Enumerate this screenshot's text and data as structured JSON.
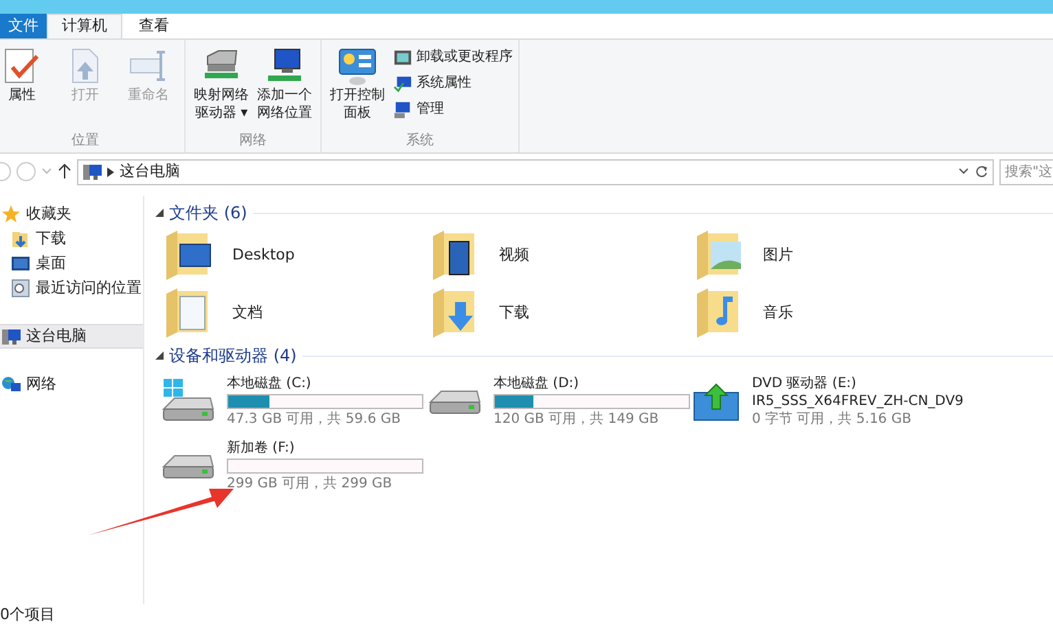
{
  "ribbon": {
    "tabs": [
      {
        "label": "文件",
        "kind": "file",
        "selected": false
      },
      {
        "label": "计算机",
        "kind": "tab",
        "selected": true
      },
      {
        "label": "查看",
        "kind": "tab",
        "selected": false
      }
    ],
    "groups": [
      {
        "label": "位置",
        "items": [
          {
            "label": "属性",
            "kind": "props",
            "disabled": false
          },
          {
            "label": "打开",
            "kind": "open",
            "disabled": true
          },
          {
            "label": "重命名",
            "kind": "rename",
            "disabled": true
          }
        ]
      },
      {
        "label": "网络",
        "items": [
          {
            "label": "映射网络驱动器 ▾",
            "kind": "mapdrive",
            "disabled": false
          },
          {
            "label": "添加一个网络位置",
            "kind": "netloc",
            "disabled": false
          }
        ]
      },
      {
        "label": "系统",
        "items": [
          {
            "label": "打开控制面板",
            "kind": "control",
            "disabled": false
          }
        ],
        "small_items": [
          {
            "label": "卸载或更改程序",
            "kind": "uninstall"
          },
          {
            "label": "系统属性",
            "kind": "sysprops"
          },
          {
            "label": "管理",
            "kind": "manage"
          }
        ]
      }
    ]
  },
  "address_bar": {
    "path": "这台电脑",
    "search_placeholder": "搜索\"这"
  },
  "nav": [
    {
      "label": "收藏夹",
      "kind": "star",
      "selected": false,
      "children": [
        {
          "label": "下载",
          "kind": "download",
          "selected": false
        },
        {
          "label": "桌面",
          "kind": "desktop",
          "selected": false
        },
        {
          "label": "最近访问的位置",
          "kind": "recent",
          "selected": false
        }
      ]
    },
    {
      "label": "这台电脑",
      "kind": "pc",
      "selected": true
    },
    {
      "label": "网络",
      "kind": "network",
      "selected": false
    }
  ],
  "folders": {
    "title": "文件夹 (6)",
    "items": [
      {
        "name": "Desktop",
        "kind": "desktop"
      },
      {
        "name": "视频",
        "kind": "video"
      },
      {
        "name": "图片",
        "kind": "pictures"
      },
      {
        "name": "文档",
        "kind": "docs"
      },
      {
        "name": "下载",
        "kind": "download"
      },
      {
        "name": "音乐",
        "kind": "music"
      }
    ]
  },
  "drives": {
    "title": "设备和驱动器 (4)",
    "items": [
      {
        "name": "本地磁盘 (C:)",
        "kind": "system",
        "level": 0.21,
        "info": "47.3 GB 可用，共 59.6 GB"
      },
      {
        "name": "本地磁盘 (D:)",
        "kind": "disk",
        "level": 0.2,
        "info": "120 GB 可用，共 149 GB"
      },
      {
        "name": "DVD 驱动器 (E:)",
        "kind": "dvd",
        "label": "IR5_SSS_X64FREV_ZH-CN_DV9",
        "info": "0 字节 可用，共 5.16 GB"
      },
      {
        "name": "新加卷 (F:)",
        "kind": "disk",
        "level": 0,
        "info": "299 GB 可用，共 299 GB"
      }
    ]
  },
  "status_bar": "0个项目"
}
